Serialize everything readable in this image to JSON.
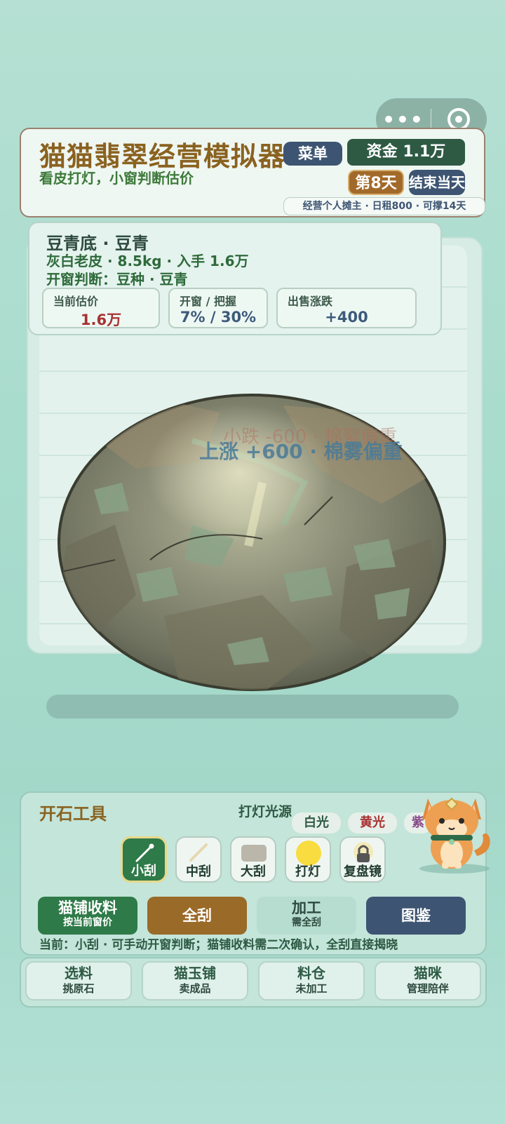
{
  "header": {
    "title": "猫猫翡翠经营模拟器",
    "subtitle": "看皮打灯，小窗判断估价",
    "menu_label": "菜单",
    "funds": "资金 1.1万",
    "day": "第8天",
    "end_day_label": "结束当天",
    "status": "经营个人摊主 · 日租800 · 可撑14天"
  },
  "stone": {
    "name": "豆青底 · 豆青",
    "desc": "灰白老皮 · 8.5kg · 入手 1.6万",
    "window_judge": "开窗判断：豆种 · 豆青",
    "stats": [
      {
        "label": "当前估价",
        "value": "1.6万"
      },
      {
        "label": "开窗 / 把握",
        "value": "7% / 30%"
      },
      {
        "label": "出售涨跌",
        "value": "+400"
      }
    ],
    "float_up": "上涨 +600 · 棉雾偏重",
    "float_down": "小跌 -600 · 棉絮偏重"
  },
  "tools": {
    "title": "开石工具",
    "light_title": "打灯光源",
    "lights": [
      "白光",
      "黄光",
      "紫"
    ],
    "buttons": [
      {
        "label": "小刮",
        "icon": "scraper-small-icon"
      },
      {
        "label": "中刮",
        "icon": "scraper-medium-icon"
      },
      {
        "label": "大刮",
        "icon": "scraper-large-icon"
      },
      {
        "label": "打灯",
        "icon": "lamp-icon"
      },
      {
        "label": "复盘镜",
        "icon": "lock-lens-icon"
      }
    ],
    "actions": [
      {
        "label": "猫铺收料",
        "sub": "按当前窗价"
      },
      {
        "label": "全刮",
        "sub": ""
      },
      {
        "label": "加工",
        "sub": "需全刮"
      },
      {
        "label": "图鉴",
        "sub": ""
      }
    ],
    "hint": "当前：小刮 · 可手动开窗判断；猫铺收料需二次确认，全刮直接揭晓"
  },
  "nav": [
    {
      "label": "选料",
      "sub": "挑原石"
    },
    {
      "label": "猫玉铺",
      "sub": "卖成品"
    },
    {
      "label": "料仓",
      "sub": "未加工"
    },
    {
      "label": "猫咪",
      "sub": "管理陪伴"
    }
  ],
  "colors": {
    "accent_brown": "#8a6220",
    "dark_green": "#2e5a44",
    "navy": "#3d5472",
    "price_red": "#a83232",
    "stat_blue": "#3d5a7a"
  }
}
